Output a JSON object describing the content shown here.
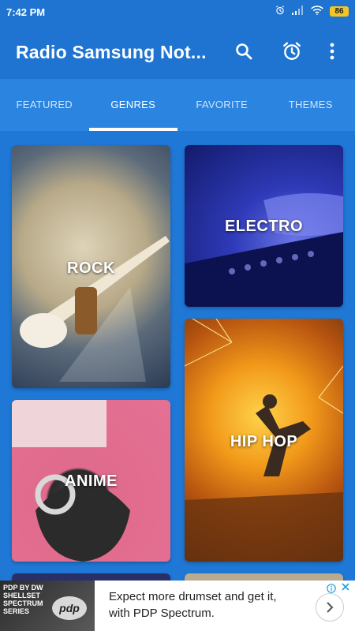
{
  "status_bar": {
    "time": "7:42 PM",
    "battery": "86"
  },
  "app_bar": {
    "title": "Radio Samsung Not..."
  },
  "tabs": [
    {
      "label": "FEATURED",
      "active": false
    },
    {
      "label": "GENRES",
      "active": true
    },
    {
      "label": "FAVORITE",
      "active": false
    },
    {
      "label": "THEMES",
      "active": false
    }
  ],
  "genres": [
    {
      "label": "ROCK"
    },
    {
      "label": "ELECTRO"
    },
    {
      "label": "ANIME"
    },
    {
      "label": "HIP HOP"
    }
  ],
  "ad": {
    "brand_text": "PDP BY DW SHELLSET SPECTRUM SERIES",
    "logo_text": "pdp",
    "body": "Expect more drumset and get it, with PDP Spectrum."
  },
  "colors": {
    "primary": "#1e74d0",
    "background": "#1f78d6",
    "tab_bar": "#2a84e0"
  }
}
